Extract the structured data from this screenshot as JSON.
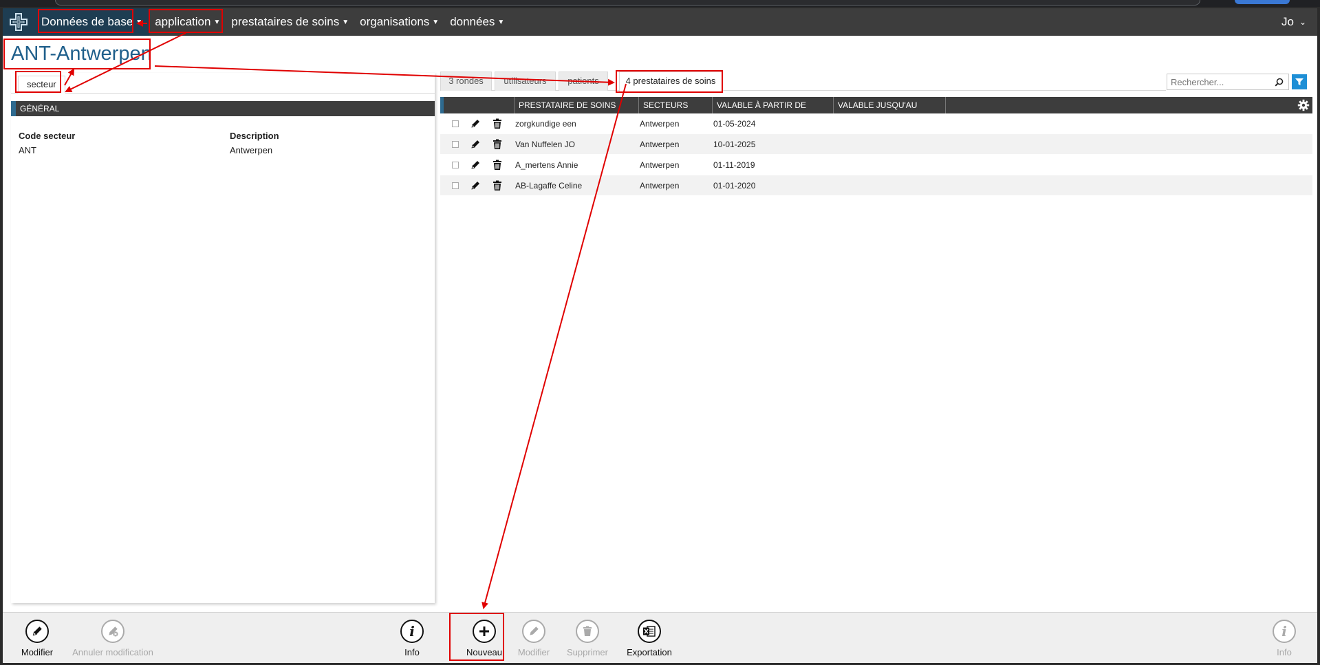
{
  "navbar": {
    "home_label": "Données de base",
    "menus": [
      {
        "label": "application"
      },
      {
        "label": "prestataires de soins"
      },
      {
        "label": "organisations"
      },
      {
        "label": "données"
      }
    ],
    "user": "Jo"
  },
  "page": {
    "title": "ANT-Antwerpen"
  },
  "left_panel": {
    "tab": "secteur",
    "section_title": "GÉNÉRAL",
    "fields": [
      {
        "label": "Code secteur",
        "value": "ANT"
      },
      {
        "label": "Description",
        "value": "Antwerpen"
      }
    ]
  },
  "right_panel": {
    "tabs": [
      "3 rondes",
      "utilisateurs",
      "patients",
      "4 prestataires de soins"
    ],
    "active_tab": "4 prestataires de soins",
    "search": {
      "placeholder": "Rechercher...",
      "value": ""
    },
    "columns": [
      "PRESTATAIRE DE SOINS",
      "SECTEURS",
      "VALABLE À PARTIR DE",
      "VALABLE JUSQU'AU"
    ],
    "rows": [
      {
        "prestataire": "zorgkundige een",
        "secteurs": "Antwerpen",
        "debut": "01-05-2024",
        "fin": ""
      },
      {
        "prestataire": "Van Nuffelen JO",
        "secteurs": "Antwerpen",
        "debut": "10-01-2025",
        "fin": ""
      },
      {
        "prestataire": "A_mertens Annie",
        "secteurs": "Antwerpen",
        "debut": "01-11-2019",
        "fin": ""
      },
      {
        "prestataire": "AB-Lagaffe Celine",
        "secteurs": "Antwerpen",
        "debut": "01-01-2020",
        "fin": ""
      }
    ]
  },
  "toolbar": {
    "left": [
      {
        "label": "Modifier",
        "icon": "pencil-icon",
        "enabled": true
      },
      {
        "label": "Annuler modification",
        "icon": "pencil-cancel-icon",
        "enabled": false
      }
    ],
    "center": [
      {
        "label": "Info",
        "icon": "info-icon",
        "enabled": true
      },
      {
        "label": "Nouveau",
        "icon": "plus-icon",
        "enabled": true
      },
      {
        "label": "Modifier",
        "icon": "pencil-icon",
        "enabled": false
      },
      {
        "label": "Supprimer",
        "icon": "trash-icon",
        "enabled": false
      },
      {
        "label": "Exportation",
        "icon": "excel-icon",
        "enabled": true
      }
    ],
    "right": [
      {
        "label": "Info",
        "icon": "info-icon",
        "enabled": false
      }
    ]
  },
  "colors": {
    "navbar": "#3d3d3d",
    "brand": "#1e3d52",
    "accent": "#2e6a8f",
    "title": "#1f5f8b",
    "filter": "#1e8fd6",
    "annotation": "#e00000"
  }
}
